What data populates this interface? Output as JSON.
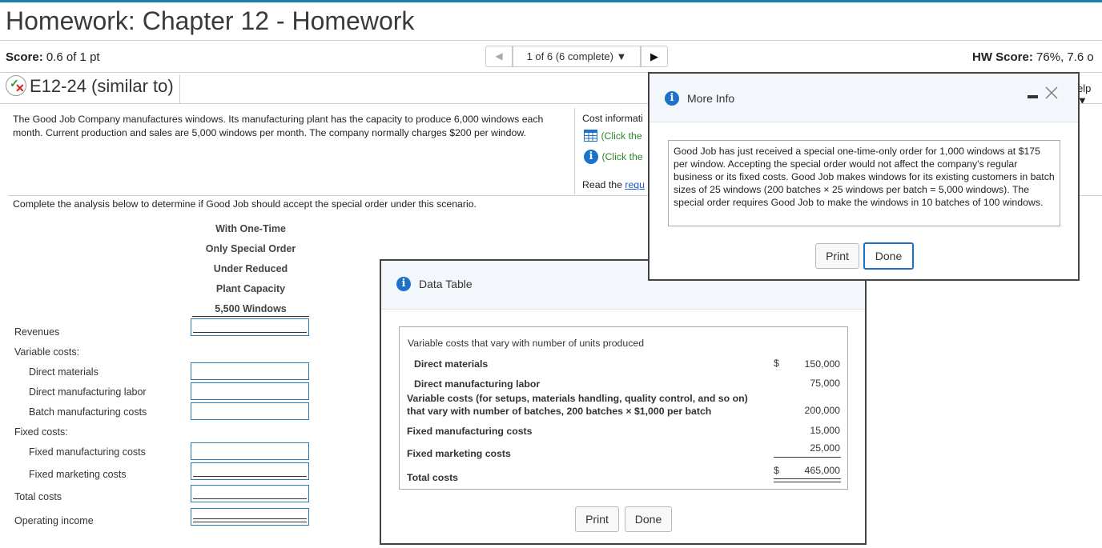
{
  "header": {
    "title": "Homework: Chapter 12 - Homework",
    "score_label": "Score:",
    "score_value": "0.6 of 1 pt",
    "nav_prev": "◀",
    "nav_position": "1 of 6 (6 complete) ▼",
    "nav_next": "▶",
    "hw_score_label": "HW Score:",
    "hw_score_value": "76%, 7.6 o",
    "question_id": "E12-24 (similar to)",
    "help_label": "elp ▼"
  },
  "question": {
    "description": "The Good Job Company manufactures windows. Its manufacturing plant has the capacity to produce 6,000 windows each month. Current production and sales are 5,000 windows per month. The company normally charges $200 per window.",
    "cost_info_label": "Cost informati",
    "click_link_1": "(Click the",
    "click_link_2": "(Click the",
    "read_the": "Read the",
    "requirements_link": "requ",
    "instruction": "Complete the analysis below to determine if Good Job should accept the special order under this scenario."
  },
  "analysis": {
    "column_header": [
      "With One-Time",
      "Only Special Order",
      "Under Reduced",
      "Plant Capacity",
      "5,500 Windows"
    ],
    "rows": {
      "revenues": "Revenues",
      "variable_costs": "Variable costs:",
      "direct_materials": "Direct materials",
      "direct_labor": "Direct manufacturing labor",
      "batch_costs": "Batch manufacturing costs",
      "fixed_costs": "Fixed costs:",
      "fixed_manufacturing": "Fixed manufacturing costs",
      "fixed_marketing": "Fixed marketing costs",
      "total_costs": "Total costs",
      "operating_income": "Operating income"
    },
    "input_values": {
      "revenues": "",
      "direct_materials": "",
      "direct_labor": "",
      "batch_costs": "",
      "fixed_manufacturing": "",
      "fixed_marketing": "",
      "total_costs": "",
      "operating_income": ""
    }
  },
  "more_info_dialog": {
    "title": "More Info",
    "text": "Good Job has just received a special one-time-only order for 1,000 windows at $175 per window. Accepting the special order would not affect the company's regular business or its fixed costs. Good Job makes windows for its existing customers in batch sizes of 25 windows (200 batches × 25 windows per batch = 5,000 windows). The special order requires Good Job to make the windows in 10 batches of 100 windows.",
    "print_label": "Print",
    "done_label": "Done"
  },
  "data_table_dialog": {
    "title": "Data Table",
    "heading": "Variable costs that vary with number of units produced",
    "direct_materials": "Direct materials",
    "direct_materials_dollar": "$",
    "direct_materials_value": "150,000",
    "direct_labor": "Direct manufacturing labor",
    "direct_labor_value": "75,000",
    "batch_line1": "Variable costs (for setups, materials handling, quality control, and so on)",
    "batch_line2": "that vary with number of batches, 200 batches × $1,000 per batch",
    "batch_value": "200,000",
    "fixed_manufacturing": "Fixed manufacturing costs",
    "fixed_manufacturing_value": "15,000",
    "fixed_marketing": "Fixed marketing costs",
    "fixed_marketing_value": "25,000",
    "total": "Total costs",
    "total_dollar": "$",
    "total_value": "465,000",
    "print_label": "Print",
    "done_label": "Done"
  },
  "colors": {
    "accent": "#1c72c9",
    "top_bar": "#1a7fa8",
    "link_green": "#2a8a2a"
  }
}
